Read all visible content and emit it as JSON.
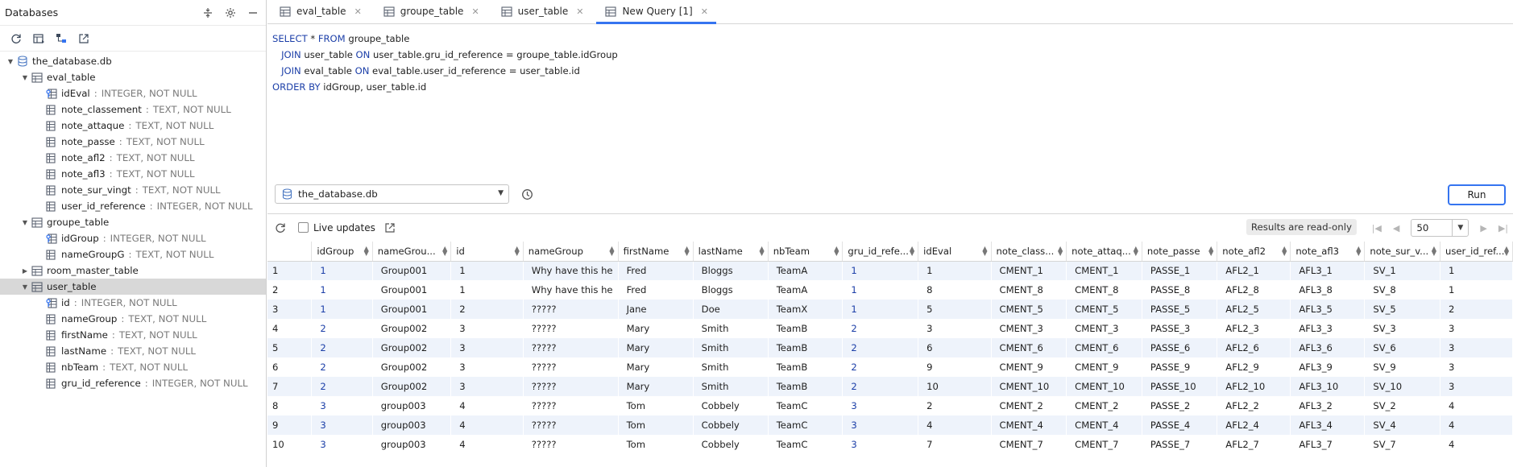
{
  "window": {
    "panel_title": "Databases"
  },
  "tree": {
    "database": "the_database.db",
    "separator": ":",
    "tables": [
      {
        "name": "eval_table",
        "expanded": true,
        "columns": [
          {
            "name": "idEval",
            "type": "INTEGER, NOT NULL",
            "key": true
          },
          {
            "name": "note_classement",
            "type": "TEXT, NOT NULL",
            "key": false
          },
          {
            "name": "note_attaque",
            "type": "TEXT, NOT NULL",
            "key": false
          },
          {
            "name": "note_passe",
            "type": "TEXT, NOT NULL",
            "key": false
          },
          {
            "name": "note_afl2",
            "type": "TEXT, NOT NULL",
            "key": false
          },
          {
            "name": "note_afl3",
            "type": "TEXT, NOT NULL",
            "key": false
          },
          {
            "name": "note_sur_vingt",
            "type": "TEXT, NOT NULL",
            "key": false
          },
          {
            "name": "user_id_reference",
            "type": "INTEGER, NOT NULL",
            "key": false
          }
        ]
      },
      {
        "name": "groupe_table",
        "expanded": true,
        "columns": [
          {
            "name": "idGroup",
            "type": "INTEGER, NOT NULL",
            "key": true
          },
          {
            "name": "nameGroupG",
            "type": "TEXT, NOT NULL",
            "key": false
          }
        ]
      },
      {
        "name": "room_master_table",
        "expanded": false,
        "columns": []
      },
      {
        "name": "user_table",
        "expanded": true,
        "selected": true,
        "columns": [
          {
            "name": "id",
            "type": "INTEGER, NOT NULL",
            "key": true
          },
          {
            "name": "nameGroup",
            "type": "TEXT, NOT NULL",
            "key": false
          },
          {
            "name": "firstName",
            "type": "TEXT, NOT NULL",
            "key": false
          },
          {
            "name": "lastName",
            "type": "TEXT, NOT NULL",
            "key": false
          },
          {
            "name": "nbTeam",
            "type": "TEXT, NOT NULL",
            "key": false
          },
          {
            "name": "gru_id_reference",
            "type": "INTEGER, NOT NULL",
            "key": false
          }
        ]
      }
    ]
  },
  "tabs": [
    {
      "label": "eval_table",
      "active": false
    },
    {
      "label": "groupe_table",
      "active": false
    },
    {
      "label": "user_table",
      "active": false
    },
    {
      "label": "New Query [1]",
      "active": true
    }
  ],
  "query": {
    "lines": [
      [
        {
          "t": "SELECT",
          "kw": true
        },
        {
          "t": " * ",
          "kw": false
        },
        {
          "t": "FROM",
          "kw": true
        },
        {
          "t": " groupe_table",
          "kw": false
        }
      ],
      [
        {
          "t": "   ",
          "kw": false
        },
        {
          "t": "JOIN",
          "kw": true
        },
        {
          "t": " user_table ",
          "kw": false
        },
        {
          "t": "ON",
          "kw": true
        },
        {
          "t": " user_table.gru_id_reference = groupe_table.idGroup",
          "kw": false
        }
      ],
      [
        {
          "t": "   ",
          "kw": false
        },
        {
          "t": "JOIN",
          "kw": true
        },
        {
          "t": " eval_table ",
          "kw": false
        },
        {
          "t": "ON",
          "kw": true
        },
        {
          "t": " eval_table.user_id_reference = user_table.id",
          "kw": false
        }
      ],
      [
        {
          "t": "ORDER BY",
          "kw": true
        },
        {
          "t": " idGroup, user_table.id",
          "kw": false
        }
      ]
    ]
  },
  "controls": {
    "database_selected": "the_database.db",
    "run_label": "Run",
    "live_updates_label": "Live updates",
    "readonly_label": "Results are read-only",
    "page_size": "50"
  },
  "results": {
    "columns": [
      "idGroup",
      "nameGrou...",
      "id",
      "nameGroup",
      "firstName",
      "lastName",
      "nbTeam",
      "gru_id_refe...",
      "idEval",
      "note_class...",
      "note_attaq...",
      "note_passe",
      "note_afl2",
      "note_afl3",
      "note_sur_v...",
      "user_id_ref..."
    ],
    "rows": [
      [
        "1",
        "1",
        "Group001",
        "1",
        "Why have this he",
        "Fred",
        "Bloggs",
        "TeamA",
        "1",
        "1",
        "CMENT_1",
        "CMENT_1",
        "PASSE_1",
        "AFL2_1",
        "AFL3_1",
        "SV_1",
        "1"
      ],
      [
        "2",
        "1",
        "Group001",
        "1",
        "Why have this he",
        "Fred",
        "Bloggs",
        "TeamA",
        "1",
        "8",
        "CMENT_8",
        "CMENT_8",
        "PASSE_8",
        "AFL2_8",
        "AFL3_8",
        "SV_8",
        "1"
      ],
      [
        "3",
        "1",
        "Group001",
        "2",
        "?????",
        "Jane",
        "Doe",
        "TeamX",
        "1",
        "5",
        "CMENT_5",
        "CMENT_5",
        "PASSE_5",
        "AFL2_5",
        "AFL3_5",
        "SV_5",
        "2"
      ],
      [
        "4",
        "2",
        "Group002",
        "3",
        "?????",
        "Mary",
        "Smith",
        "TeamB",
        "2",
        "3",
        "CMENT_3",
        "CMENT_3",
        "PASSE_3",
        "AFL2_3",
        "AFL3_3",
        "SV_3",
        "3"
      ],
      [
        "5",
        "2",
        "Group002",
        "3",
        "?????",
        "Mary",
        "Smith",
        "TeamB",
        "2",
        "6",
        "CMENT_6",
        "CMENT_6",
        "PASSE_6",
        "AFL2_6",
        "AFL3_6",
        "SV_6",
        "3"
      ],
      [
        "6",
        "2",
        "Group002",
        "3",
        "?????",
        "Mary",
        "Smith",
        "TeamB",
        "2",
        "9",
        "CMENT_9",
        "CMENT_9",
        "PASSE_9",
        "AFL2_9",
        "AFL3_9",
        "SV_9",
        "3"
      ],
      [
        "7",
        "2",
        "Group002",
        "3",
        "?????",
        "Mary",
        "Smith",
        "TeamB",
        "2",
        "10",
        "CMENT_10",
        "CMENT_10",
        "PASSE_10",
        "AFL2_10",
        "AFL3_10",
        "SV_10",
        "3"
      ],
      [
        "8",
        "3",
        "group003",
        "4",
        "?????",
        "Tom",
        "Cobbely",
        "TeamC",
        "3",
        "2",
        "CMENT_2",
        "CMENT_2",
        "PASSE_2",
        "AFL2_2",
        "AFL3_2",
        "SV_2",
        "4"
      ],
      [
        "9",
        "3",
        "group003",
        "4",
        "?????",
        "Tom",
        "Cobbely",
        "TeamC",
        "3",
        "4",
        "CMENT_4",
        "CMENT_4",
        "PASSE_4",
        "AFL2_4",
        "AFL3_4",
        "SV_4",
        "4"
      ],
      [
        "10",
        "3",
        "group003",
        "4",
        "?????",
        "Tom",
        "Cobbely",
        "TeamC",
        "3",
        "7",
        "CMENT_7",
        "CMENT_7",
        "PASSE_7",
        "AFL2_7",
        "AFL3_7",
        "SV_7",
        "4"
      ]
    ]
  },
  "colors": {
    "accent": "#3574f0",
    "keyword": "#1c3fa8",
    "key_column_fk": "#3574f0",
    "stripe": "#eef3fb"
  }
}
